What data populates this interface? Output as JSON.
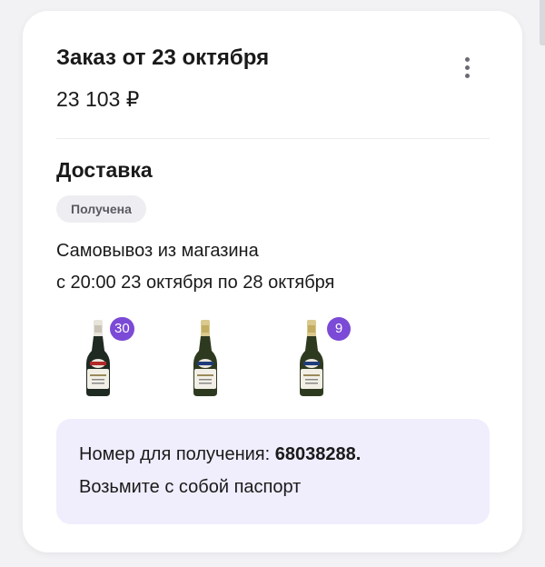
{
  "order": {
    "title": "Заказ от 23 октября",
    "price": "23 103 ₽"
  },
  "delivery": {
    "section_title": "Доставка",
    "status": "Получена",
    "type": "Самовывоз из магазина",
    "time": "с 20:00 23 октября по 28 октября"
  },
  "products": [
    {
      "name": "Martini sparkling wine bottle",
      "qty": "30"
    },
    {
      "name": "Martini sparkling wine bottle",
      "qty": ""
    },
    {
      "name": "Martini sparkling wine bottle",
      "qty": "9"
    }
  ],
  "pickup": {
    "label": "Номер для получения: ",
    "code": "68038288.",
    "note": "Возьмите с собой паспорт"
  },
  "colors": {
    "accent": "#7b4ad6",
    "info_bg": "#f0edfd",
    "badge_bg": "#eeeef2"
  },
  "icons": {
    "menu": "more-vertical-icon"
  }
}
